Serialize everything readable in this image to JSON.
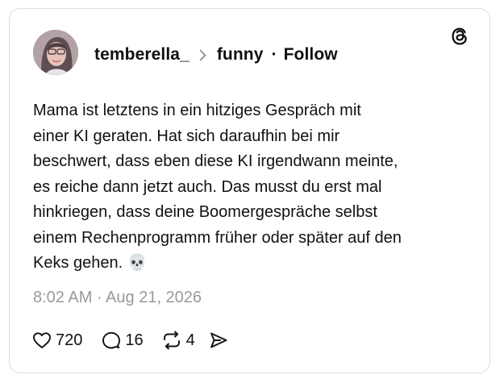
{
  "post": {
    "username": "temberella_",
    "community": "funny",
    "separator": "·",
    "follow_label": "Follow",
    "text": "Mama ist letztens in ein hitziges Gespräch mit\neiner KI geraten. Hat sich daraufhin bei mir\nbeschwert, dass eben diese KI irgendwann meinte,\nes reiche dann jetzt auch. Das musst du erst mal\nhinkriegen, dass deine Boomergespräche selbst\neinem Rechenprogramm früher oder später auf den\nKeks gehen. 💀",
    "timestamp": "8:02 AM · Aug 21, 2026"
  },
  "actions": {
    "likes": "720",
    "comments": "16",
    "reposts": "4"
  },
  "icons": {
    "brand": "threads-logo-icon",
    "like": "heart-icon",
    "comment": "speech-bubble-icon",
    "repost": "repost-arrows-icon",
    "share": "send-icon",
    "chevron": "chevron-right-icon"
  },
  "colors": {
    "text": "#101010",
    "muted": "#9a9a9a",
    "border": "#dcdcdc"
  }
}
